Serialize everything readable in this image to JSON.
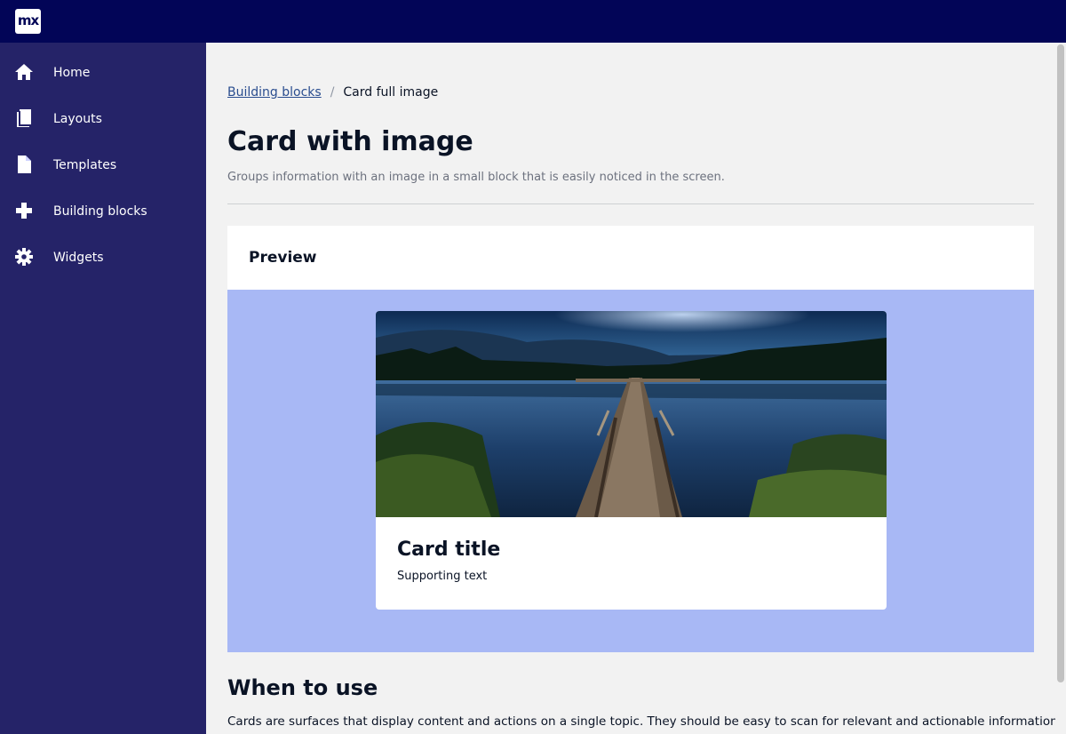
{
  "app": {
    "logo_text": "mx",
    "brand_color": "#020557",
    "sidebar_color": "#252368"
  },
  "sidebar": {
    "items": [
      {
        "label": "Home",
        "icon": "home-icon"
      },
      {
        "label": "Layouts",
        "icon": "book-icon"
      },
      {
        "label": "Templates",
        "icon": "file-icon"
      },
      {
        "label": "Building blocks",
        "icon": "plus-icon"
      },
      {
        "label": "Widgets",
        "icon": "gear-icon"
      }
    ]
  },
  "breadcrumb": {
    "parent": "Building blocks",
    "separator": "/",
    "current": "Card full image"
  },
  "page": {
    "title": "Card with image",
    "subtitle": "Groups information with an image in a small block that is easily noticed in the screen."
  },
  "preview": {
    "title": "Preview",
    "background": "#a8b8f5",
    "card": {
      "image": "lake-pier-photo",
      "title": "Card title",
      "text": "Supporting text"
    }
  },
  "when_to_use": {
    "title": "When to use",
    "text": "Cards are surfaces that display content and actions on a single topic. They should be easy to scan for relevant and actionable information."
  }
}
